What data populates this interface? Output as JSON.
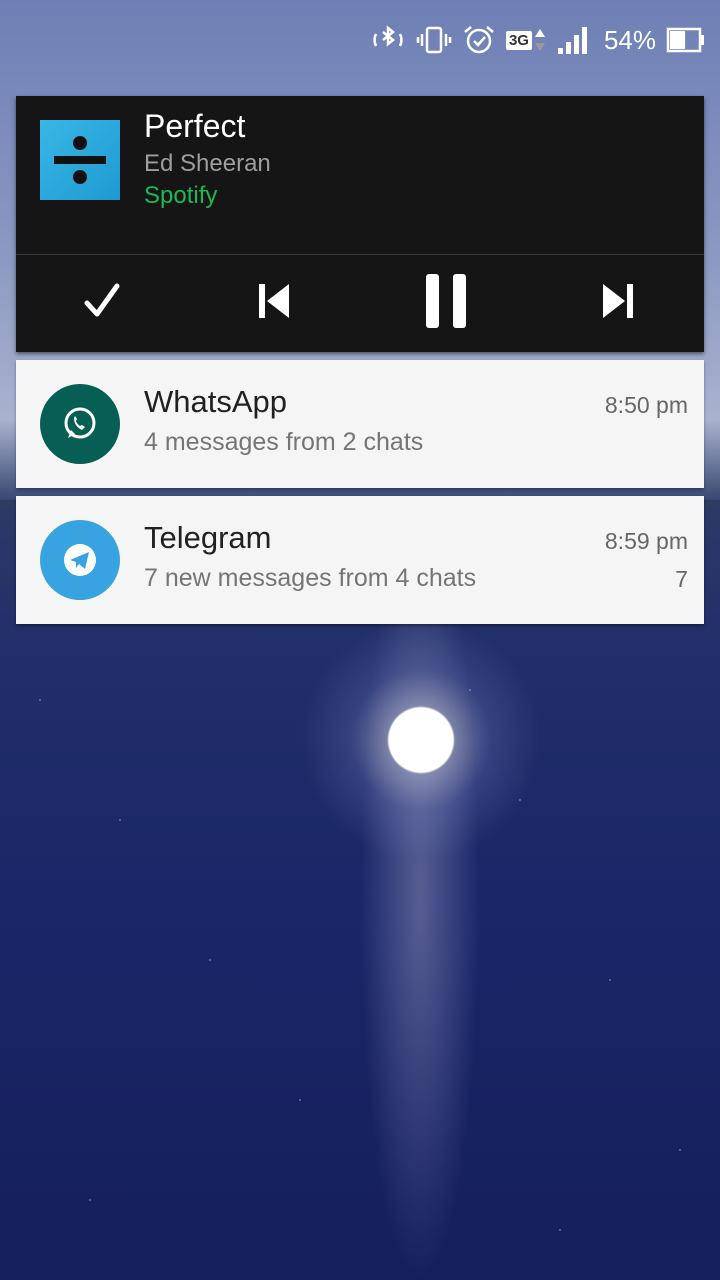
{
  "status_bar": {
    "network_type": "3G",
    "battery_percent": "54%",
    "battery_level": 0.54,
    "icons": [
      "bluetooth-icon",
      "vibrate-icon",
      "alarm-icon",
      "network-3g-icon",
      "signal-icon",
      "battery-icon"
    ]
  },
  "music": {
    "title": "Perfect",
    "artist": "Ed Sheeran",
    "app": "Spotify",
    "app_color": "#1db954",
    "controls": [
      "check-icon",
      "previous-icon",
      "pause-icon",
      "next-icon"
    ]
  },
  "notifications": [
    {
      "app": "WhatsApp",
      "time": "8:50 pm",
      "text": "4 messages from 2 chats",
      "count": "",
      "icon_color": "#075e54"
    },
    {
      "app": "Telegram",
      "time": "8:59 pm",
      "text": "7 new messages from 4 chats",
      "count": "7",
      "icon_color": "#37a3e0"
    }
  ]
}
